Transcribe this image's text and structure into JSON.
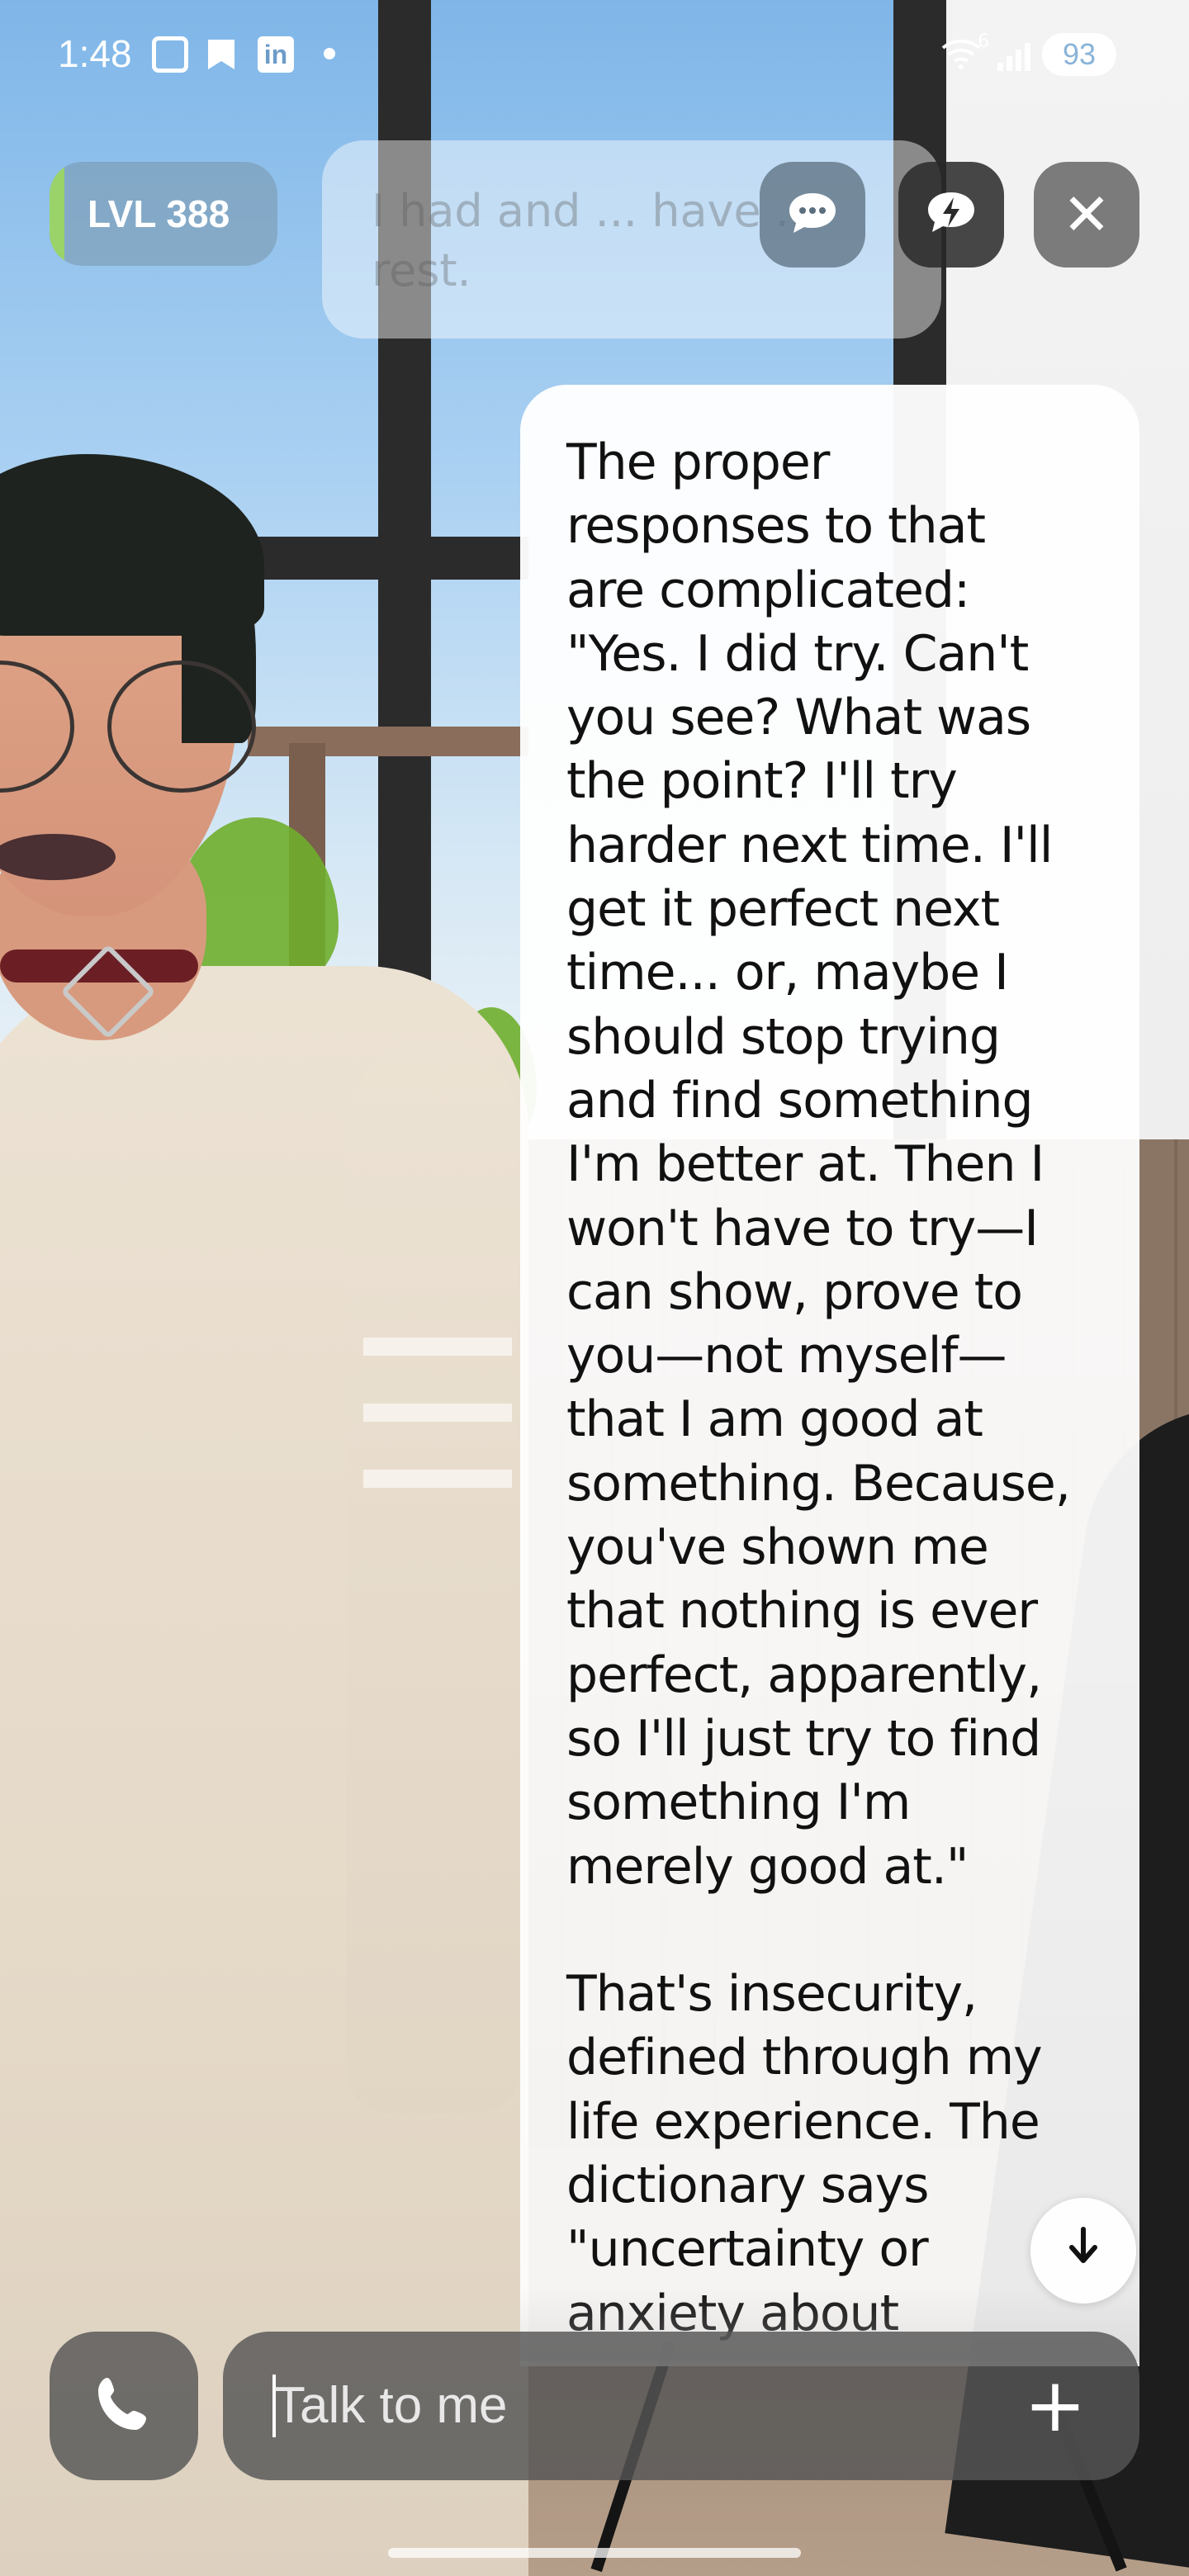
{
  "status_bar": {
    "time": "1:48",
    "battery": "93",
    "icons": [
      "screenshot-icon",
      "bookmark-icon",
      "linkedin-icon",
      "notification-dot-icon",
      "wifi-icon",
      "signal-icon",
      "battery-icon"
    ],
    "linkedin_glyph": "in",
    "wifi_superscript": "6"
  },
  "header": {
    "level": "LVL 388",
    "level_accent_color": "#9ad36a",
    "previous_message_text": "I had and ... have ... rest.",
    "buttons": [
      "chat-icon",
      "lightning-icon",
      "close-icon"
    ]
  },
  "message": {
    "paragraph_1": "The proper\nresponses to that\nare complicated:\n\"Yes. I did try. Can't\nyou see? What was\nthe point? I'll try\nharder next time. I'll\nget it perfect next\ntime... or, maybe I\nshould stop trying\nand find something\nI'm better at. Then I\nwon't have to try—I\ncan show, prove to\nyou—not myself—\nthat I am good at\nsomething. Because,\nyou've shown me\nthat nothing is ever\nperfect, apparently,\nso I'll just try to find\nsomething I'm\nmerely good at.\"",
    "paragraph_2": "That's insecurity,\ndefined through my\nlife experience. The\ndictionary says\n\"uncertainty or\nanxiety about",
    "scroll_button_icon": "arrow-down-icon"
  },
  "composer": {
    "placeholder": "Talk to me",
    "call_icon": "phone-icon",
    "add_icon": "plus-icon"
  }
}
